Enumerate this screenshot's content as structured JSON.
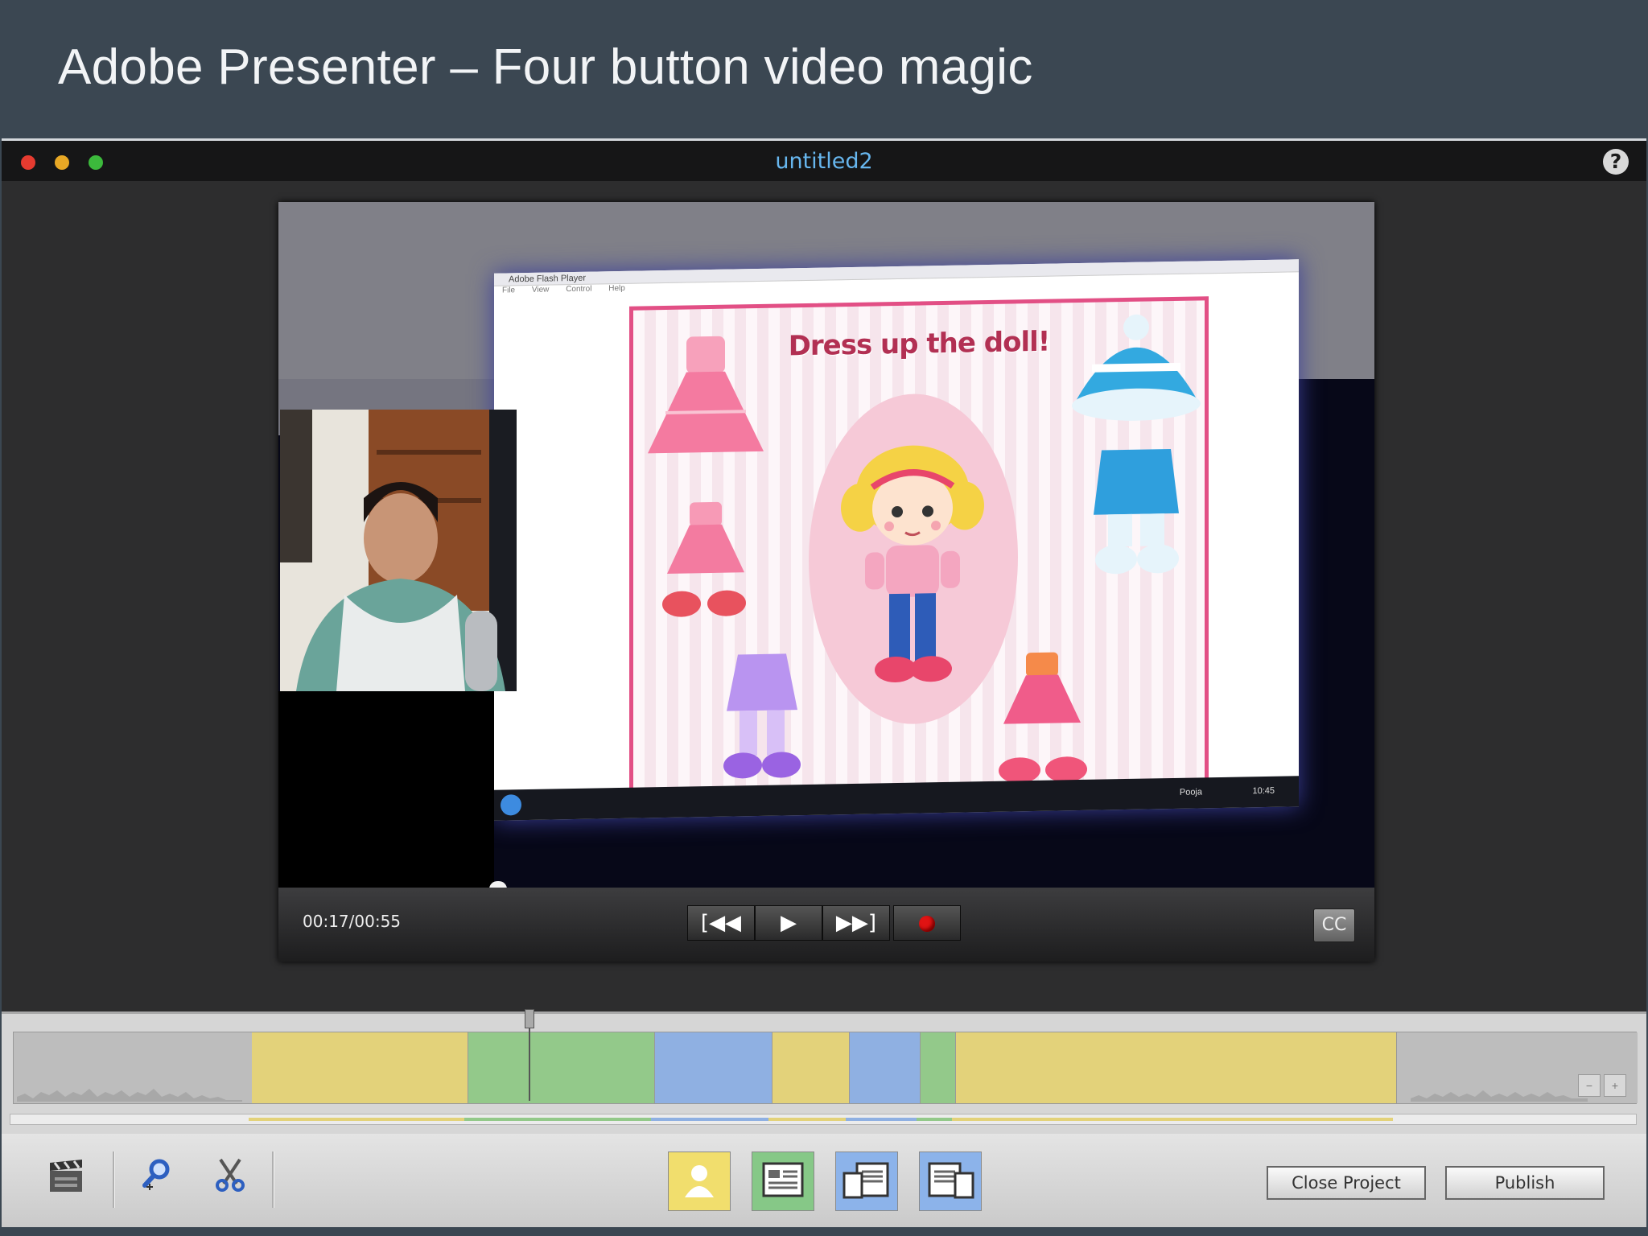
{
  "slide": {
    "title": "Adobe Presenter – Four button video magic"
  },
  "window": {
    "title": "untitled2",
    "help_icon": "question-mark-icon",
    "help_glyph": "?"
  },
  "video": {
    "game_title": "Dress up the doll!",
    "screen_titlebar": "Adobe Flash Player",
    "screen_menu": [
      "File",
      "View",
      "Control",
      "Help"
    ],
    "taskbar_user": "Pooja",
    "taskbar_time": "10:45"
  },
  "player": {
    "timecode": "00:17/00:55",
    "rewind_glyph": "[◀◀",
    "play_glyph": "▶",
    "forward_glyph": "▶▶]",
    "cc_label": "CC",
    "playback_fraction": 0.31
  },
  "timeline": {
    "colors": {
      "yellow": "#e3d27a",
      "green": "#93c98a",
      "blue": "#8fb0e2",
      "grey": "#bdbdbd"
    },
    "segments": [
      "grey",
      "yellow",
      "green",
      "blue",
      "yellow",
      "blue",
      "green",
      "yellow",
      "grey"
    ],
    "zoom_out_icon": "zoom-out-icon",
    "zoom_in_icon": "zoom-in-icon"
  },
  "toolbar": {
    "icons": [
      "clapperboard-icon",
      "zoom-icon",
      "scissors-icon"
    ],
    "layouts": [
      {
        "name": "presenter-only-layout",
        "color": "#f1de6d"
      },
      {
        "name": "content-only-layout",
        "color": "#86c887"
      },
      {
        "name": "presenter-left-layout",
        "color": "#8cb3ea"
      },
      {
        "name": "presenter-right-layout",
        "color": "#8cb3ea"
      }
    ],
    "close_label": "Close Project",
    "publish_label": "Publish"
  },
  "colors": {
    "accent_title": "#67b6ee",
    "record_red": "#e01313"
  }
}
